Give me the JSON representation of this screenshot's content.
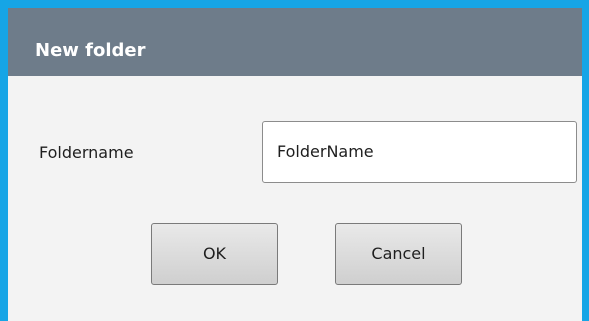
{
  "dialog": {
    "title": "New folder",
    "field_label": "Foldername",
    "field_value": "FolderName",
    "ok_label": "OK",
    "cancel_label": "Cancel"
  },
  "colors": {
    "frame_border": "#16a5e6",
    "titlebar": "#6e7c8a",
    "dialog_background": "#f3f3f3"
  }
}
